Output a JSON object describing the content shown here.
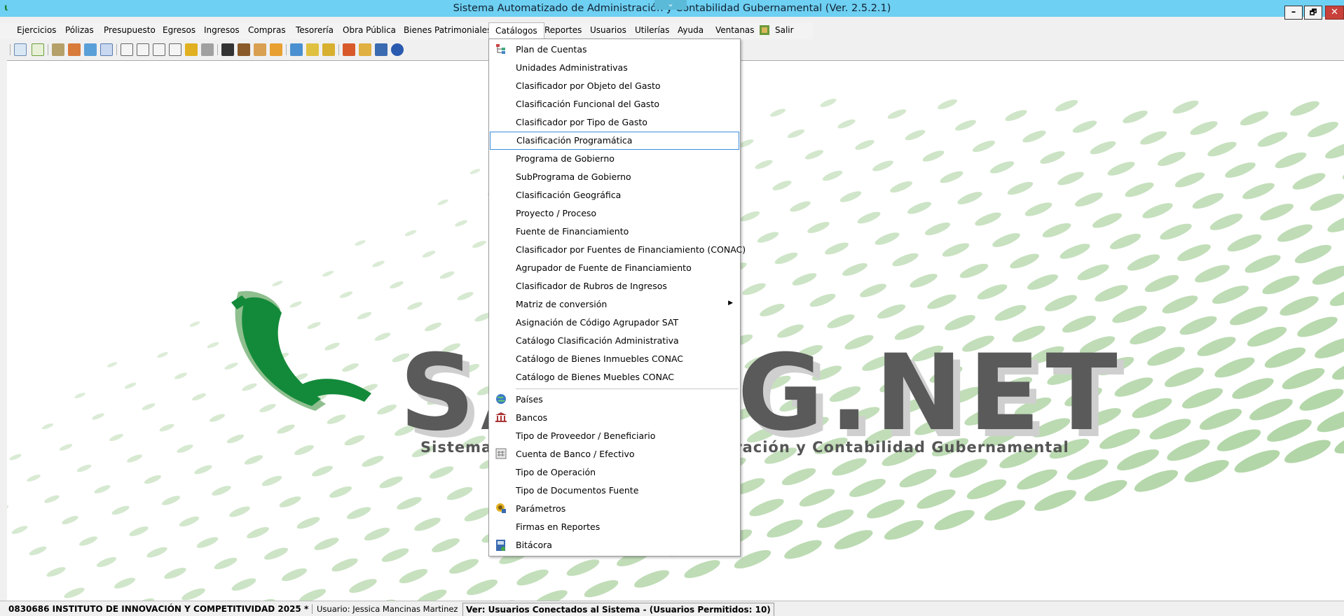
{
  "window": {
    "title": "Sistema Automatizado de Administración y Contabilidad Gubernamental  (Ver. 2.5.2.1)",
    "min_glyph": "–",
    "max_glyph": "🗗",
    "close_glyph": "✕",
    "chevron_glyph": "⌄"
  },
  "menubar": {
    "items": [
      "Ejercicios",
      "Pólizas",
      "Presupuesto",
      "Egresos",
      "Ingresos",
      "Compras",
      "Tesorería",
      "Obra Pública",
      "Bienes Patrimoniales",
      "Catálogos",
      "Reportes",
      "Usuarios",
      "Utilerías",
      "Ayuda",
      "Ventanas",
      "Salir"
    ],
    "active": "Catálogos"
  },
  "logo": {
    "wordmark": "SAACG.NET",
    "subtitle": "Sistema Automatizado de Administración y Contabilidad Gubernamental"
  },
  "dropdown": {
    "items": [
      {
        "label": "Plan de Cuentas",
        "icon": "tree-icon"
      },
      {
        "label": "Unidades Administrativas"
      },
      {
        "label": "Clasificador por Objeto del Gasto"
      },
      {
        "label": "Clasificación Funcional del Gasto"
      },
      {
        "label": "Clasificador por Tipo de Gasto"
      },
      {
        "label": "Clasificación Programática",
        "highlighted": true
      },
      {
        "label": "Programa de Gobierno"
      },
      {
        "label": "SubPrograma de Gobierno"
      },
      {
        "label": "Clasificación Geográfica"
      },
      {
        "label": "Proyecto / Proceso"
      },
      {
        "label": "Fuente de Financiamiento"
      },
      {
        "label": "Clasificador por Fuentes de Financiamiento (CONAC)"
      },
      {
        "label": "Agrupador de Fuente de Financiamiento"
      },
      {
        "label": "Clasificador de Rubros de Ingresos"
      },
      {
        "label": "Matriz de conversión",
        "submenu": true
      },
      {
        "label": "Asignación de Código Agrupador SAT"
      },
      {
        "label": "Catálogo Clasificación Administrativa"
      },
      {
        "label": "Catálogo de Bienes Inmuebles CONAC"
      },
      {
        "label": "Catálogo de Bienes Muebles CONAC"
      },
      {
        "label": "Países",
        "icon": "globe-icon"
      },
      {
        "label": "Bancos",
        "icon": "bank-icon"
      },
      {
        "label": "Tipo de Proveedor / Beneficiario"
      },
      {
        "label": "Cuenta de Banco / Efectivo",
        "icon": "calculator-icon"
      },
      {
        "label": "Tipo de Operación"
      },
      {
        "label": "Tipo de Documentos Fuente"
      },
      {
        "label": "Parámetros",
        "icon": "settings-icon"
      },
      {
        "label": "Firmas en Reportes"
      },
      {
        "label": "Bitácora",
        "icon": "log-icon"
      }
    ]
  },
  "statusbar": {
    "institution": "0830686 INSTITUTO DE INNOVACIÓN Y COMPETITIVIDAD  2025   *",
    "user": "Usuario: Jessica Mancinas Martinez",
    "version_info": "Ver: Usuarios Conectados al Sistema - (Usuarios Permitidos: 10)"
  },
  "colors": {
    "titlebar": "#6ed0f2",
    "logo_green": "#138a3a",
    "pattern_green": "#a6cf9a",
    "highlight_border": "#3b8ed8"
  }
}
